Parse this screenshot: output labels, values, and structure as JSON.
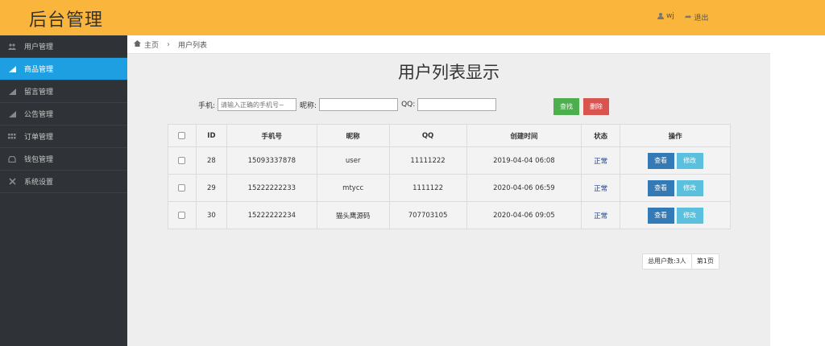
{
  "header": {
    "title": "后台管理",
    "user": "wj",
    "logout": "退出"
  },
  "sidebar": {
    "items": [
      {
        "label": "用户管理",
        "icon": "users-icon",
        "active": false
      },
      {
        "label": "商品管理",
        "icon": "bar-chart-icon",
        "active": true
      },
      {
        "label": "留言管理",
        "icon": "bar-chart-icon",
        "active": false
      },
      {
        "label": "公告管理",
        "icon": "bar-chart-icon",
        "active": false
      },
      {
        "label": "订单管理",
        "icon": "grid-icon",
        "active": false
      },
      {
        "label": "钱包管理",
        "icon": "wallet-icon",
        "active": false
      },
      {
        "label": "系统设置",
        "icon": "settings-icon",
        "active": false
      }
    ]
  },
  "breadcrumb": {
    "home": "主页",
    "current": "用户列表"
  },
  "main": {
    "title": "用户列表显示"
  },
  "search": {
    "phone_label": "手机:",
    "phone_placeholder": "请输入正确的手机号~",
    "nick_label": "昵称:",
    "qq_label": "QQ:",
    "find_button": "查找",
    "delete_button": "删除"
  },
  "table": {
    "headers": [
      "ID",
      "手机号",
      "昵称",
      "QQ",
      "创建时间",
      "状态",
      "操作"
    ],
    "rows": [
      {
        "id": "28",
        "phone": "15093337878",
        "nick": "user",
        "qq": "11111222",
        "created": "2019-04-04 06:08",
        "status": "正常"
      },
      {
        "id": "29",
        "phone": "15222222233",
        "nick": "mtycc",
        "qq": "1111122",
        "created": "2020-04-06 06:59",
        "status": "正常"
      },
      {
        "id": "30",
        "phone": "15222222234",
        "nick": "猫头鹰源码",
        "qq": "707703105",
        "created": "2020-04-06 09:05",
        "status": "正常"
      }
    ],
    "view_label": "查看",
    "edit_label": "修改"
  },
  "pager": {
    "total": "总用户数:3人",
    "page": "第1页"
  },
  "colors": {
    "header_bg": "#f9b53c",
    "sidebar_bg": "#2f3236",
    "sidebar_active": "#1e9fe1",
    "find_button": "#4cae4c",
    "delete_button": "#d9534f",
    "view_button": "#337ab7",
    "edit_button": "#5bc0de"
  }
}
